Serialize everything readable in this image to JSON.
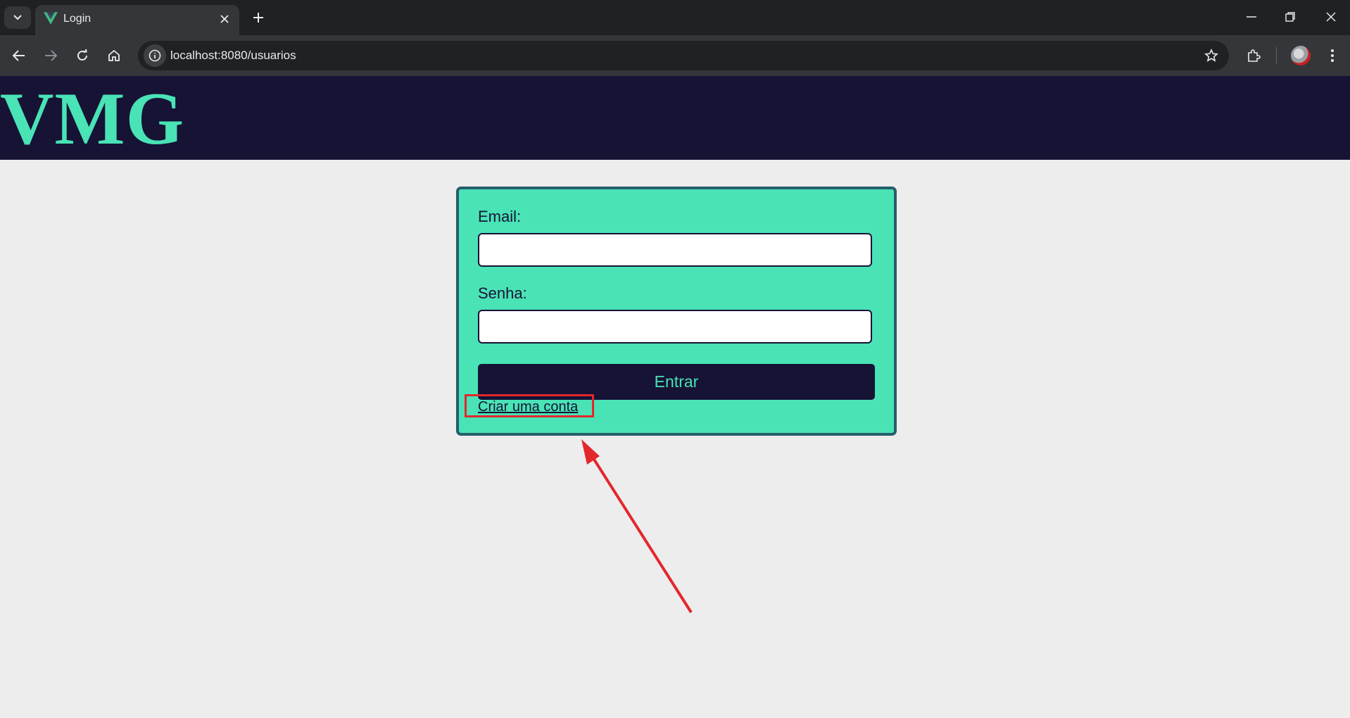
{
  "browser": {
    "tab_title": "Login",
    "url": "localhost:8080/usuarios",
    "icons": [
      "tab-search-icon",
      "vue-logo-icon",
      "close-icon",
      "plus-icon",
      "minimize-icon",
      "restore-icon",
      "close-window-icon",
      "back-arrow-icon",
      "forward-arrow-icon",
      "reload-icon",
      "home-icon",
      "site-info-icon",
      "star-icon",
      "extensions-icon",
      "avatar",
      "more-vert-icon"
    ]
  },
  "app": {
    "logo": "VMG"
  },
  "login_form": {
    "email_label": "Email:",
    "email_value": "",
    "password_label": "Senha:",
    "password_value": "",
    "submit_label": "Entrar",
    "create_account_link": "Criar uma conta"
  },
  "colors": {
    "header_bg": "#161335",
    "accent": "#49e3b6",
    "card_border": "#265e6b",
    "annotation": "#e3272c",
    "page_bg": "#ededed"
  }
}
